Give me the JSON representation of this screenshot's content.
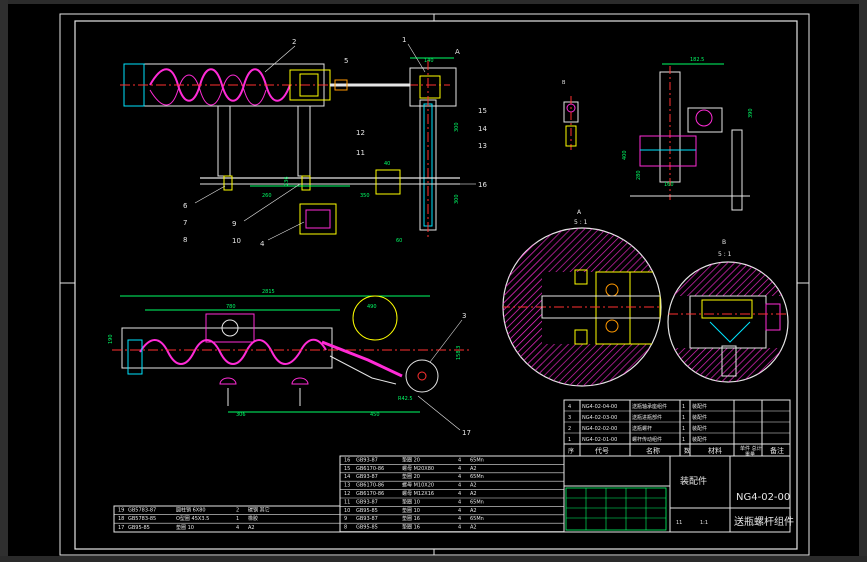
{
  "colors": {
    "background": "#000000",
    "frame": "#ffffff",
    "outline": "#e6e6e6",
    "dimension": "#00ff66",
    "centerline": "#ff3030",
    "hidden": "#ff40ff",
    "hatch": "#ff2bd6",
    "aux": "#00e5ff",
    "yellow": "#ffff00",
    "orange": "#ff9900"
  },
  "balloons": {
    "b1": "1",
    "b2": "2",
    "b3": "3",
    "b4": "4",
    "b5": "5",
    "b6": "6",
    "b7": "7",
    "b8": "8",
    "b9": "9",
    "b10": "10",
    "b11": "11",
    "b12": "12",
    "b13": "13",
    "b14": "14",
    "b15": "15",
    "b16": "16",
    "b17": "17"
  },
  "dimensions": {
    "d1": "2815",
    "d2": "780",
    "d3": "290",
    "d4": "410",
    "d5": "270",
    "d6": "306",
    "d7": "230",
    "d8": "190",
    "d9": "450",
    "d10": "282.5",
    "d11": "260",
    "d12": "158.3",
    "d13": "R42.5",
    "d14": "410",
    "d15": "350",
    "d16": "300",
    "d17": "300",
    "d18": "490",
    "d19": "236",
    "d20": "60",
    "d21": "40",
    "d22": "250",
    "d23": "140",
    "d24": "182.5",
    "d25": "390",
    "d26": "400",
    "d27": "280",
    "d28": "160",
    "d29": "135",
    "d30": "360"
  },
  "detail_labels": {
    "detail_a_ratio": "5 : 1",
    "detail_b_ratio": "5 : 1",
    "detail_a_letter": "A",
    "detail_b_letter": "B"
  },
  "title_block": {
    "drawing_number": "NG4-02-00",
    "drawing_name": "送瓶螺杆组件",
    "kind": "装配件",
    "header_seq": "序",
    "header_code": "代号",
    "header_name": "名称",
    "header_qty": "数",
    "header_material": "材料",
    "header_unit_weight": "单件 总计",
    "header_weight": "重量",
    "header_note": "备注",
    "scale": "1:1",
    "sheet": "11"
  },
  "bom_upper": [
    {
      "seq": "4",
      "code": "NG4-02-04-00",
      "name": "送瓶轴承座组件",
      "qty": "1",
      "mat": "装配件"
    },
    {
      "seq": "3",
      "code": "NG4-02-03-00",
      "name": "送瓶进瓶部件",
      "qty": "1",
      "mat": "装配件"
    },
    {
      "seq": "2",
      "code": "NG4-02-02-00",
      "name": "送瓶螺杆",
      "qty": "1",
      "mat": "装配件"
    },
    {
      "seq": "1",
      "code": "NG4-02-01-00",
      "name": "螺杆传动组件",
      "qty": "1",
      "mat": "装配件"
    }
  ],
  "bom_lower": [
    {
      "seq": "16",
      "code": "GB93-87",
      "name": "垫圈 20",
      "qty": "4",
      "mat": "65Mn"
    },
    {
      "seq": "15",
      "code": "GB6170-86",
      "name": "螺母 M20X80",
      "qty": "4",
      "mat": "A2"
    },
    {
      "seq": "14",
      "code": "GB93-87",
      "name": "垫圈 20",
      "qty": "4",
      "mat": "65Mn"
    },
    {
      "seq": "13",
      "code": "GB6170-86",
      "name": "螺母 M10X20",
      "qty": "4",
      "mat": "A2"
    },
    {
      "seq": "12",
      "code": "GB6170-86",
      "name": "螺母 M12X16",
      "qty": "4",
      "mat": "A2"
    },
    {
      "seq": "11",
      "code": "GB93-87",
      "name": "垫圈 10",
      "qty": "4",
      "mat": "65Mn"
    },
    {
      "seq": "10",
      "code": "GB95-85",
      "name": "垫圈 10",
      "qty": "4",
      "mat": "A2"
    },
    {
      "seq": "9",
      "code": "GB93-87",
      "name": "垫圈 16",
      "qty": "4",
      "mat": "65Mn"
    },
    {
      "seq": "8",
      "code": "GB95-85",
      "name": "垫圈 16",
      "qty": "4",
      "mat": "A2"
    }
  ],
  "bom_left": [
    {
      "seq": "19",
      "code": "GB5783-87",
      "name": "圆柱销 6X80",
      "qty": "2",
      "mat": "碳钢 其它"
    },
    {
      "seq": "18",
      "code": "GB5783-85",
      "name": "O型圈 45X3.5",
      "qty": "1",
      "mat": "橡胶"
    },
    {
      "seq": "17",
      "code": "GB95-85",
      "name": "垫圈 10",
      "qty": "4",
      "mat": "A2"
    }
  ]
}
